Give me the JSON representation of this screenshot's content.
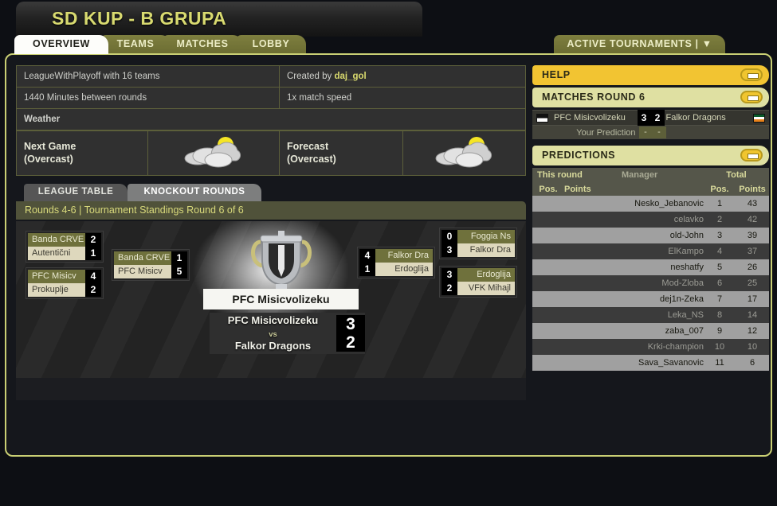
{
  "app": {
    "title": "SD KUP - B GRUPA"
  },
  "tabs": [
    {
      "label": "OVERVIEW",
      "active": true
    },
    {
      "label": "TEAMS",
      "active": false
    },
    {
      "label": "MATCHES",
      "active": false
    },
    {
      "label": "LOBBY",
      "active": false
    }
  ],
  "active_tournaments": {
    "label": "ACTIVE TOURNAMENTS |",
    "caret": "▼"
  },
  "info": {
    "format": "LeagueWithPlayoff with 16 teams",
    "created_by_label": "Created by",
    "created_by": "daj_gol",
    "round_time": "1440 Minutes between rounds",
    "match_speed": "1x match speed",
    "weather_header": "Weather",
    "next_game_label": "Next Game\n(Overcast)",
    "next_game_l1": "Next Game",
    "next_game_l2": "(Overcast)",
    "forecast_l1": "Forecast",
    "forecast_l2": "(Overcast)",
    "weather_icon": "overcast-cloud-sun-icon"
  },
  "subtabs": {
    "league_table": "LEAGUE TABLE",
    "knockout_rounds": "KNOCKOUT ROUNDS",
    "standings": "Rounds 4-6 | Tournament Standings Round 6 of 6"
  },
  "bracket": {
    "quarterfinals_left": [
      {
        "teams": [
          "Banda CRVE",
          "Autentični"
        ],
        "scores": [
          "2",
          "1"
        ],
        "winner_index": 0
      },
      {
        "teams": [
          "PFC Misicv",
          "Prokuplje"
        ],
        "scores": [
          "4",
          "2"
        ],
        "winner_index": 0
      }
    ],
    "semifinal_left": {
      "teams": [
        "Banda CRVE",
        "PFC Misicv"
      ],
      "scores": [
        "1",
        "5"
      ],
      "winner_index": 0
    },
    "semifinal_right": {
      "teams": [
        "Falkor Dra",
        "Erdoglija"
      ],
      "scores": [
        "4",
        "1"
      ],
      "winner_index": 0
    },
    "quarterfinals_right": [
      {
        "teams": [
          "Foggia Ns",
          "Falkor Dra"
        ],
        "scores": [
          "0",
          "3"
        ],
        "winner_index": 0
      },
      {
        "teams": [
          "Erdoglija",
          "VFK Mihajl"
        ],
        "scores": [
          "3",
          "2"
        ],
        "winner_index": 0
      }
    ],
    "winner_banner": "PFC Misicvolizeku",
    "final": {
      "home": "PFC Misicvolizeku",
      "vs": "vs",
      "away": "Falkor Dragons",
      "home_score": "3",
      "away_score": "2"
    },
    "trophy_icon": "trophy-cup-icon"
  },
  "panels": {
    "help": {
      "title": "HELP",
      "collapse_icon": "collapse-icon"
    },
    "matches": {
      "title": "MATCHES ROUND 6",
      "collapse_icon": "collapse-icon",
      "home_team": "PFC Misicvolizeku",
      "away_team": "Falkor Dragons",
      "home_score": "3",
      "away_score": "2",
      "home_flag": "black-white-flag-icon",
      "away_flag": "green-white-orange-flag-icon",
      "prediction_label": "Your Prediction",
      "prediction_home": "-",
      "prediction_away": "-"
    },
    "predictions": {
      "title": "PREDICTIONS",
      "collapse_icon": "collapse-icon",
      "header_this_round": "This round",
      "header_manager": "Manager",
      "header_total": "Total",
      "col_pos": "Pos.",
      "col_points": "Points",
      "col_total_pos": "Pos.",
      "col_total_points": "Points",
      "rows": [
        {
          "round_pos": "",
          "round_points": "",
          "manager": "Nesko_Jebanovic",
          "total_pos": "1",
          "total_points": "43"
        },
        {
          "round_pos": "",
          "round_points": "",
          "manager": "celavko",
          "total_pos": "2",
          "total_points": "42"
        },
        {
          "round_pos": "",
          "round_points": "",
          "manager": "old-John",
          "total_pos": "3",
          "total_points": "39"
        },
        {
          "round_pos": "",
          "round_points": "",
          "manager": "ElKampo",
          "total_pos": "4",
          "total_points": "37"
        },
        {
          "round_pos": "",
          "round_points": "",
          "manager": "neshatfy",
          "total_pos": "5",
          "total_points": "26"
        },
        {
          "round_pos": "",
          "round_points": "",
          "manager": "Mod-Zloba",
          "total_pos": "6",
          "total_points": "25"
        },
        {
          "round_pos": "",
          "round_points": "",
          "manager": "dej1n-Zeka",
          "total_pos": "7",
          "total_points": "17"
        },
        {
          "round_pos": "",
          "round_points": "",
          "manager": "Leka_NS",
          "total_pos": "8",
          "total_points": "14"
        },
        {
          "round_pos": "",
          "round_points": "",
          "manager": "zaba_007",
          "total_pos": "9",
          "total_points": "12"
        },
        {
          "round_pos": "",
          "round_points": "",
          "manager": "Krki-champion",
          "total_pos": "10",
          "total_points": "10"
        },
        {
          "round_pos": "",
          "round_points": "",
          "manager": "Sava_Savanovic",
          "total_pos": "11",
          "total_points": "6"
        }
      ]
    }
  },
  "colors": {
    "accent_yellow": "#d8da70",
    "frame_border": "#c9cf74",
    "help_header": "#f2c432",
    "panel_header": "#dfe0a2",
    "win_row": "#6f713c",
    "lose_row": "#ded8bd"
  }
}
